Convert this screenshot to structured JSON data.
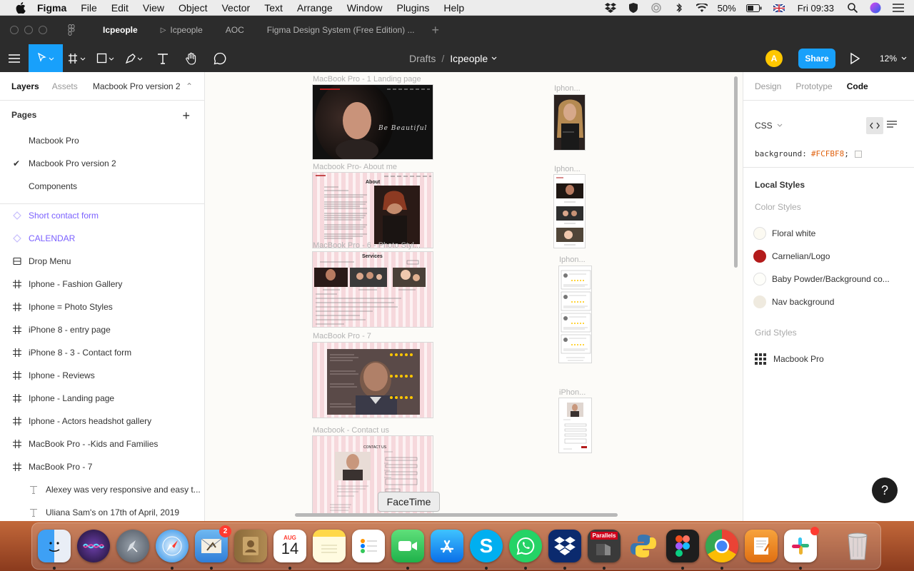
{
  "menubar": {
    "items": [
      "Figma",
      "File",
      "Edit",
      "View",
      "Object",
      "Vector",
      "Text",
      "Arrange",
      "Window",
      "Plugins",
      "Help"
    ],
    "battery": "50%",
    "clock": "Fri 09:33"
  },
  "tabs": [
    {
      "label": "Icpeople",
      "active": true
    },
    {
      "label": "Icpeople",
      "active": false
    },
    {
      "label": "AOC",
      "active": false
    },
    {
      "label": "Figma Design System (Free Edition) ...",
      "active": false
    }
  ],
  "toolbar": {
    "breadcrumb_root": "Drafts",
    "breadcrumb_sep": "/",
    "file_name": "Icpeople",
    "avatar_initial": "A",
    "share_label": "Share",
    "zoom": "12%"
  },
  "left_panel": {
    "tab_layers": "Layers",
    "tab_assets": "Assets",
    "current_page": "Macbook Pro version 2",
    "pages_header": "Pages",
    "pages": [
      {
        "label": "Macbook Pro",
        "selected": false
      },
      {
        "label": "Macbook Pro version 2",
        "selected": true
      },
      {
        "label": "Components",
        "selected": false
      }
    ],
    "layers": [
      {
        "label": "Short contact form",
        "kind": "component"
      },
      {
        "label": "CALENDAR",
        "kind": "component"
      },
      {
        "label": "Drop Menu",
        "kind": "group"
      },
      {
        "label": "Iphone - Fashion Gallery",
        "kind": "frame"
      },
      {
        "label": "Iphone = Photo Styles",
        "kind": "frame"
      },
      {
        "label": "iPhone 8 - entry page",
        "kind": "frame"
      },
      {
        "label": "iPhone 8 - 3 - Contact form",
        "kind": "frame"
      },
      {
        "label": "Iphone - Reviews",
        "kind": "frame"
      },
      {
        "label": "Iphone - Landing page",
        "kind": "frame"
      },
      {
        "label": "Iphone - Actors headshot gallery",
        "kind": "frame"
      },
      {
        "label": "MacBook Pro - -Kids and Families",
        "kind": "frame"
      },
      {
        "label": "MacBook Pro - 7",
        "kind": "frame"
      },
      {
        "label": "Alexey was very responsive and easy t...",
        "kind": "text"
      },
      {
        "label": "Uliana Sam's on 17th of April, 2019",
        "kind": "text"
      }
    ]
  },
  "canvas": {
    "frames": [
      {
        "label": "MacBook Pro - 1 Landing page"
      },
      {
        "label": "Macbook Pro- About me"
      },
      {
        "label": "MacBook Pro - 6 - Photo Styl..."
      },
      {
        "label": "MacBook Pro - 7"
      },
      {
        "label": "Macbook - Contact us"
      },
      {
        "label": "Iphon..."
      },
      {
        "label": "Iphon..."
      },
      {
        "label": "Iphon..."
      },
      {
        "label": "iPhon..."
      }
    ],
    "landing_tagline": "Be Beautiful",
    "about_heading": "About",
    "services_heading": "Services",
    "contact_heading": "CONTACT US",
    "tooltip": "FaceTime"
  },
  "right_panel": {
    "tabs": [
      {
        "label": "Design",
        "active": false
      },
      {
        "label": "Prototype",
        "active": false
      },
      {
        "label": "Code",
        "active": true
      }
    ],
    "language": "CSS",
    "code_prop": "background:",
    "code_value": "#FCFBF8",
    "code_end": ";",
    "local_styles": "Local Styles",
    "color_styles_header": "Color Styles",
    "color_styles": [
      {
        "label": "Floral white",
        "color": "#fcfaf2"
      },
      {
        "label": "Carnelian/Logo",
        "color": "#b31b1b"
      },
      {
        "label": "Baby Powder/Background co...",
        "color": "#fefefa"
      },
      {
        "label": "Nav background",
        "color": "#efeadf"
      }
    ],
    "grid_styles_header": "Grid Styles",
    "grid_styles": [
      {
        "label": "Macbook Pro"
      }
    ],
    "help": "?"
  },
  "dock": {
    "calendar_month": "AUG",
    "calendar_day": "14",
    "mail_badge": "2",
    "parallels_label": "Parallels"
  },
  "colors": {
    "accent": "#18a0fb",
    "toolbar_bg": "#2c2c2c",
    "component": "#7b61ff"
  }
}
